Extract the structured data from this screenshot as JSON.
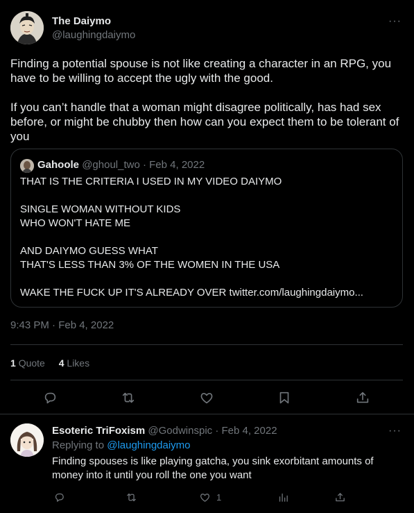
{
  "tweet": {
    "author_name": "The Daiymo",
    "author_handle": "@laughingdaiymo",
    "more_label": "···",
    "text": "Finding a potential spouse is not like creating a character in an RPG, you have to be willing to accept the ugly with the good.\n\nIf you can’t handle that a woman might disagree politically, has had sex before, or might be chubby then how can you expect them to be tolerant of you",
    "timestamp": "9:43 PM · Feb 4, 2022",
    "quote_count": "1",
    "quote_label": "Quote",
    "like_count": "4",
    "like_label": "Likes",
    "quote": {
      "author_name": "Gahoole",
      "meta": "@ghoul_two · Feb 4, 2022",
      "text": "THAT IS THE CRITERIA I USED IN MY VIDEO DAIYMO\n\nSINGLE WOMAN WITHOUT KIDS\nWHO WON'T HATE ME\n\nAND DAIYMO GUESS WHAT\nTHAT'S LESS THAN 3% OF THE WOMEN IN THE USA\n\nWAKE THE FUCK UP IT'S ALREADY OVER twitter.com/laughingdaiymo..."
    },
    "actions": [
      "reply-icon",
      "retweet-icon",
      "like-icon",
      "bookmark-icon",
      "share-icon"
    ]
  },
  "reply": {
    "author_name": "Esoteric TriFoxism",
    "meta": "@Godwinspic · Feb 4, 2022",
    "replying_to_label": "Replying to",
    "replying_to_handle": "@laughingdaiymo",
    "more_label": "···",
    "text": "Finding spouses is like playing gatcha, you sink exorbitant amounts of money into it until you roll the one you want",
    "like_count": "1"
  },
  "colors": {
    "background": "#000000",
    "text": "#e7e9ea",
    "muted": "#71767b",
    "accent": "#1d9bf0",
    "border": "#2f3336"
  }
}
